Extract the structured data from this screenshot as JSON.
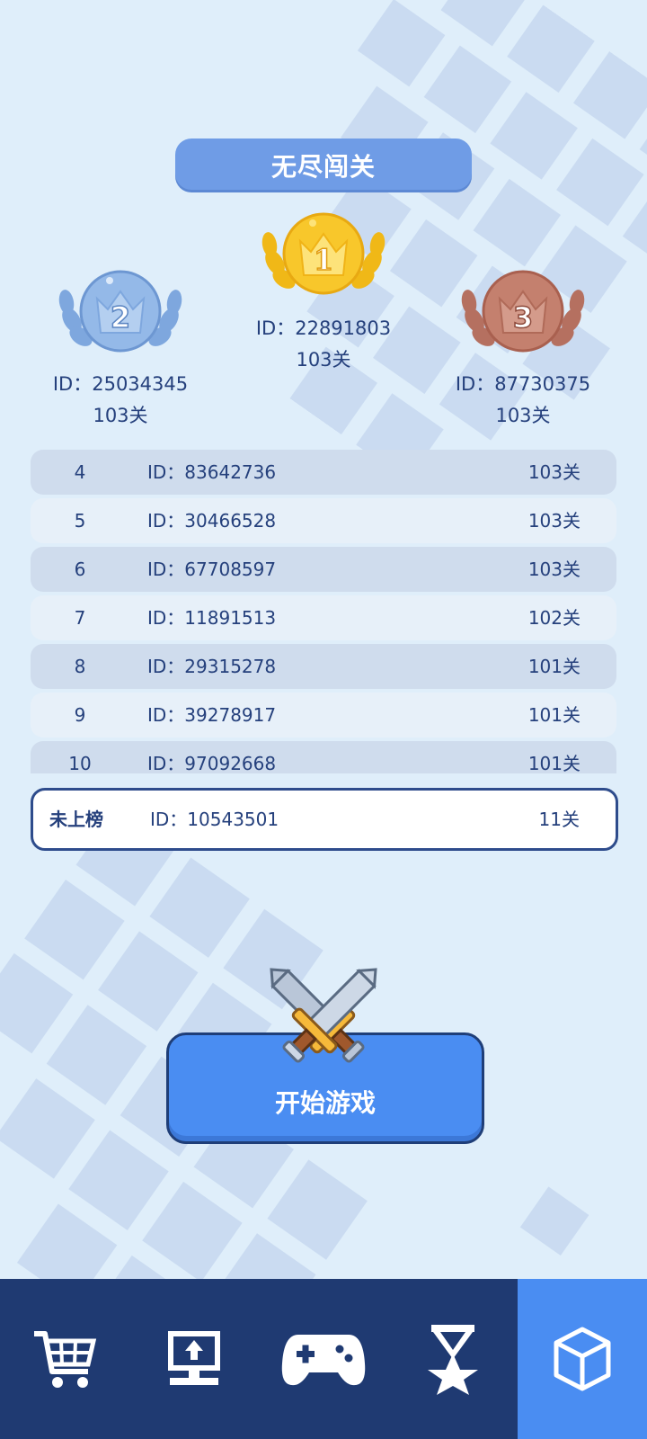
{
  "mode": {
    "title": "无尽闯关"
  },
  "podium": [
    {
      "place": "1",
      "id_text": "ID：22891803",
      "level": "103关"
    },
    {
      "place": "2",
      "id_text": "ID：25034345",
      "level": "103关"
    },
    {
      "place": "3",
      "id_text": "ID：87730375",
      "level": "103关"
    }
  ],
  "ranking": [
    {
      "rank": "4",
      "id_text": "ID：83642736",
      "level": "103关"
    },
    {
      "rank": "5",
      "id_text": "ID：30466528",
      "level": "103关"
    },
    {
      "rank": "6",
      "id_text": "ID：67708597",
      "level": "103关"
    },
    {
      "rank": "7",
      "id_text": "ID：11891513",
      "level": "102关"
    },
    {
      "rank": "8",
      "id_text": "ID：29315278",
      "level": "101关"
    },
    {
      "rank": "9",
      "id_text": "ID：39278917",
      "level": "101关"
    },
    {
      "rank": "10",
      "id_text": "ID：97092668",
      "level": "101关"
    }
  ],
  "self": {
    "rank": "未上榜",
    "id_text": "ID：10543501",
    "level": "11关"
  },
  "start_button": {
    "label": "开始游戏"
  },
  "nav": {
    "items": [
      {
        "icon": "shopping-cart-icon"
      },
      {
        "icon": "computer-upload-icon"
      },
      {
        "icon": "gamepad-icon"
      },
      {
        "icon": "ribbon-star-icon"
      },
      {
        "icon": "cube-icon",
        "active": true
      }
    ]
  },
  "colors": {
    "accent": "#4a8df2",
    "nav_bg": "#1f3a72",
    "text": "#25407c",
    "gold": "#f7c52a",
    "silver": "#8fb6e6",
    "bronze": "#c07a66"
  }
}
